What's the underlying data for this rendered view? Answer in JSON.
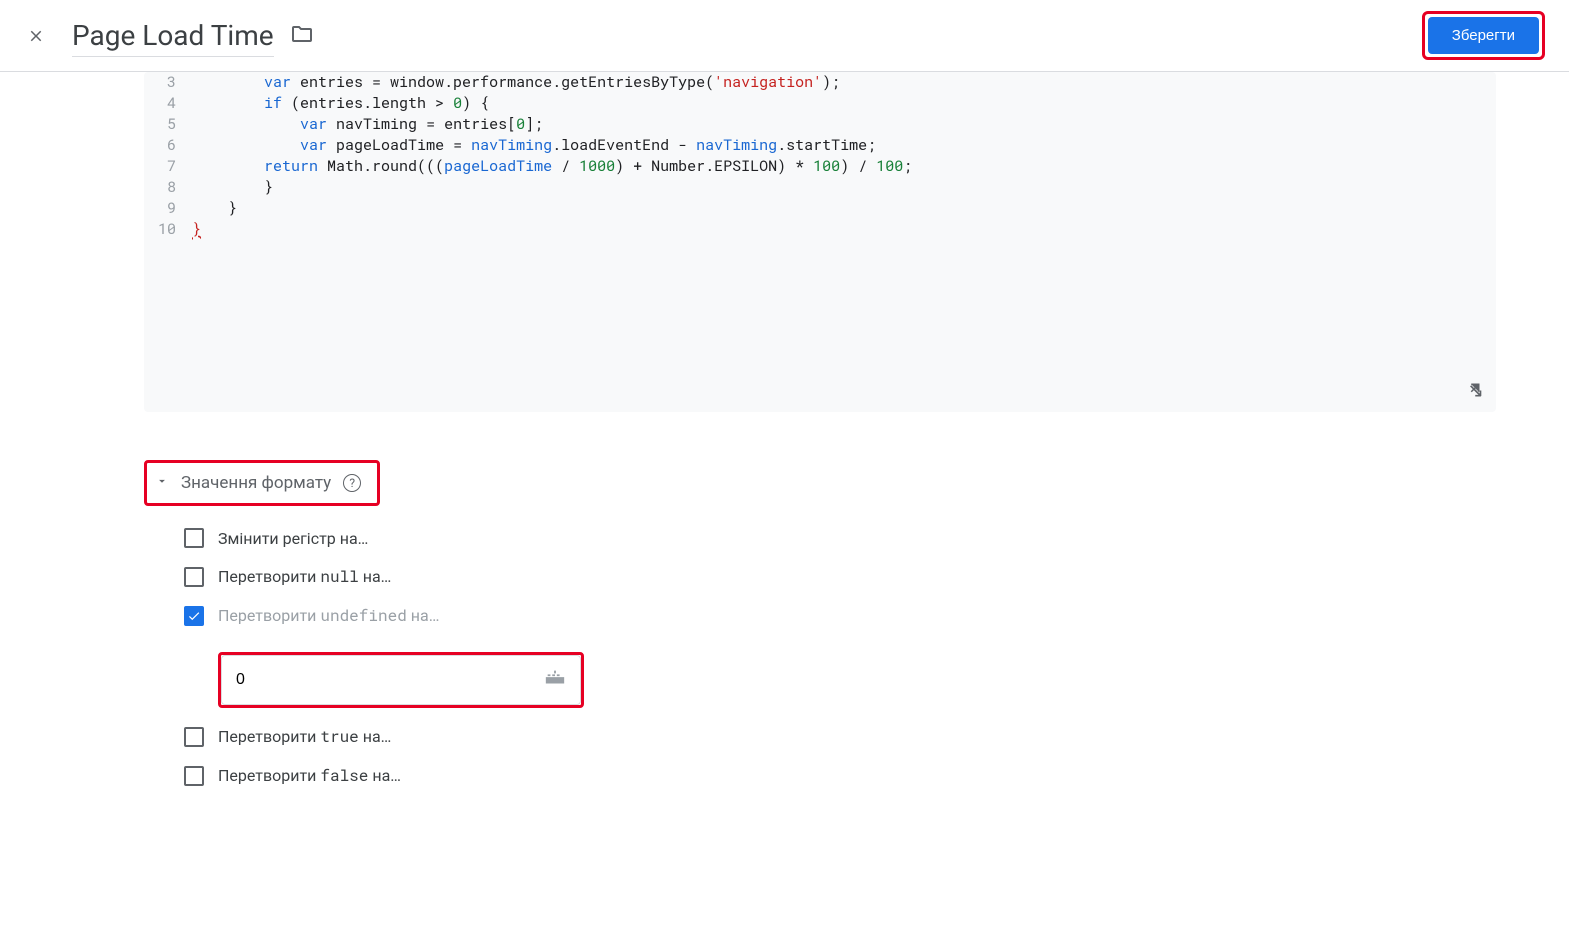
{
  "header": {
    "title": "Page Load Time",
    "save_label": "Зберегти"
  },
  "code": {
    "lines": [
      {
        "n": 3,
        "html": "        <span class='kw'>var</span> entries = window.performance.getEntriesByType(<span class='str'>'navigation'</span>);"
      },
      {
        "n": 4,
        "html": "        <span class='kw'>if</span> (entries.length &gt; <span class='num'>0</span>) {"
      },
      {
        "n": 5,
        "html": "            <span class='kw'>var</span> navTiming = entries[<span class='num'>0</span>];"
      },
      {
        "n": 6,
        "html": "            <span class='kw'>var</span> pageLoadTime = <span class='var'>navTiming</span>.loadEventEnd - <span class='var'>navTiming</span>.startTime;"
      },
      {
        "n": 7,
        "html": "        <span class='kw'>return</span> Math.round(((<span class='var'>pageLoadTime</span> / <span class='num'>1000</span>) + Number.EPSILON) * <span class='num'>100</span>) / <span class='num'>100</span>;"
      },
      {
        "n": 8,
        "html": "        }"
      },
      {
        "n": 9,
        "html": "    }"
      },
      {
        "n": 10,
        "html": "<span class='err'>}</span>"
      }
    ]
  },
  "format_section": {
    "title": "Значення формату",
    "options": {
      "change_case_prefix": "Змінити регістр на…",
      "convert_null_prefix": "Перетворити ",
      "convert_null_code": "null",
      "convert_null_suffix": " на…",
      "convert_undef_prefix": "Перетворити ",
      "convert_undef_code": "undefined",
      "convert_undef_suffix": " на…",
      "convert_true_prefix": "Перетворити ",
      "convert_true_code": "true",
      "convert_true_suffix": " на…",
      "convert_false_prefix": "Перетворити ",
      "convert_false_code": "false",
      "convert_false_suffix": " на…"
    },
    "undefined_value": "0"
  }
}
